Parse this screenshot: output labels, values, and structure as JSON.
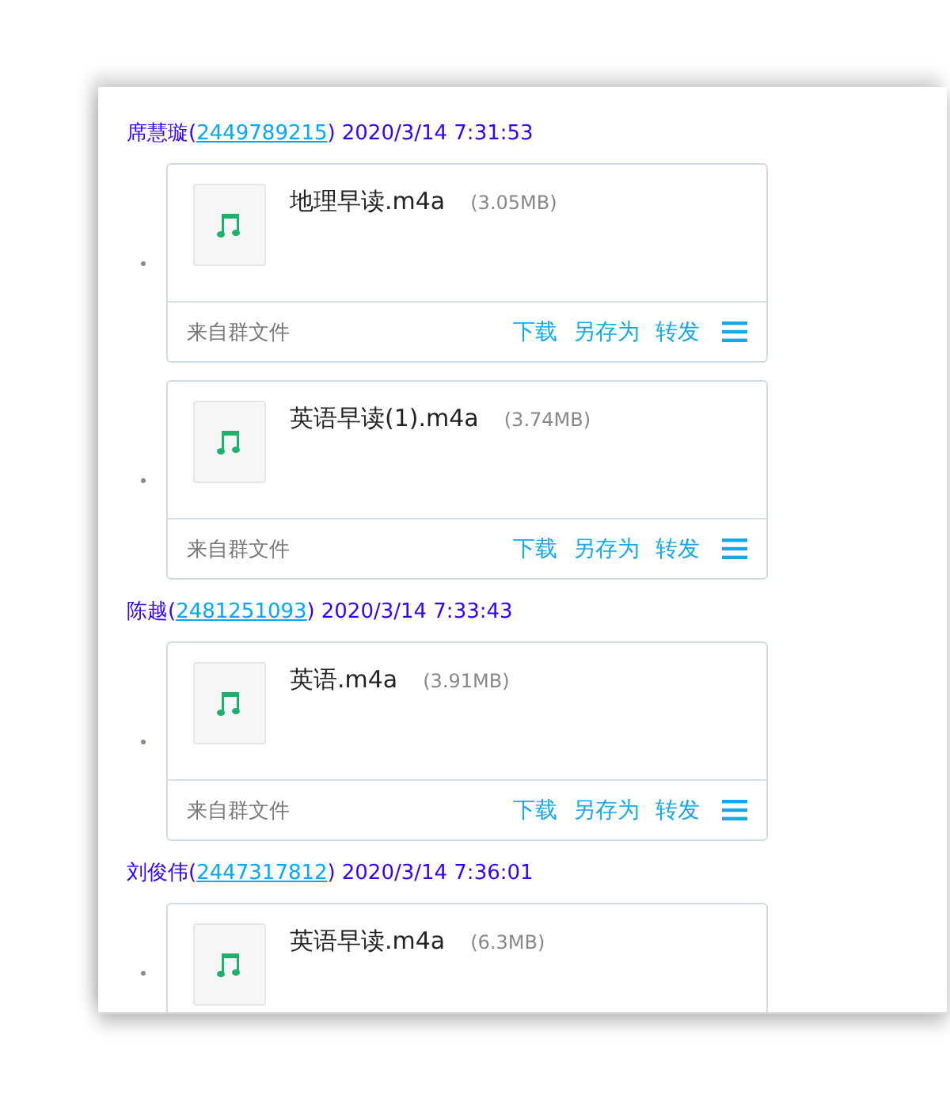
{
  "messages": [
    {
      "sender": "席慧璇(",
      "qq": "2449789215",
      "qq_close": ")",
      "time": "2020/3/14 7:31:53",
      "files": [
        {
          "name": "地理早读.m4a",
          "size": "(3.05MB)",
          "source": "来自群文件",
          "actions": [
            "下载",
            "另存为",
            "转发"
          ]
        },
        {
          "name": "英语早读(1).m4a",
          "size": "(3.74MB)",
          "source": "来自群文件",
          "actions": [
            "下载",
            "另存为",
            "转发"
          ]
        }
      ]
    },
    {
      "sender": "陈越(",
      "qq": "2481251093",
      "qq_close": ")",
      "time": "2020/3/14 7:33:43",
      "files": [
        {
          "name": "英语.m4a",
          "size": "(3.91MB)",
          "source": "来自群文件",
          "actions": [
            "下载",
            "另存为",
            "转发"
          ]
        }
      ]
    },
    {
      "sender": "刘俊伟(",
      "qq": "2447317812",
      "qq_close": ")",
      "time": "2020/3/14 7:36:01",
      "files": [
        {
          "name": "英语早读.m4a",
          "size": "(6.3MB)"
        }
      ]
    }
  ]
}
